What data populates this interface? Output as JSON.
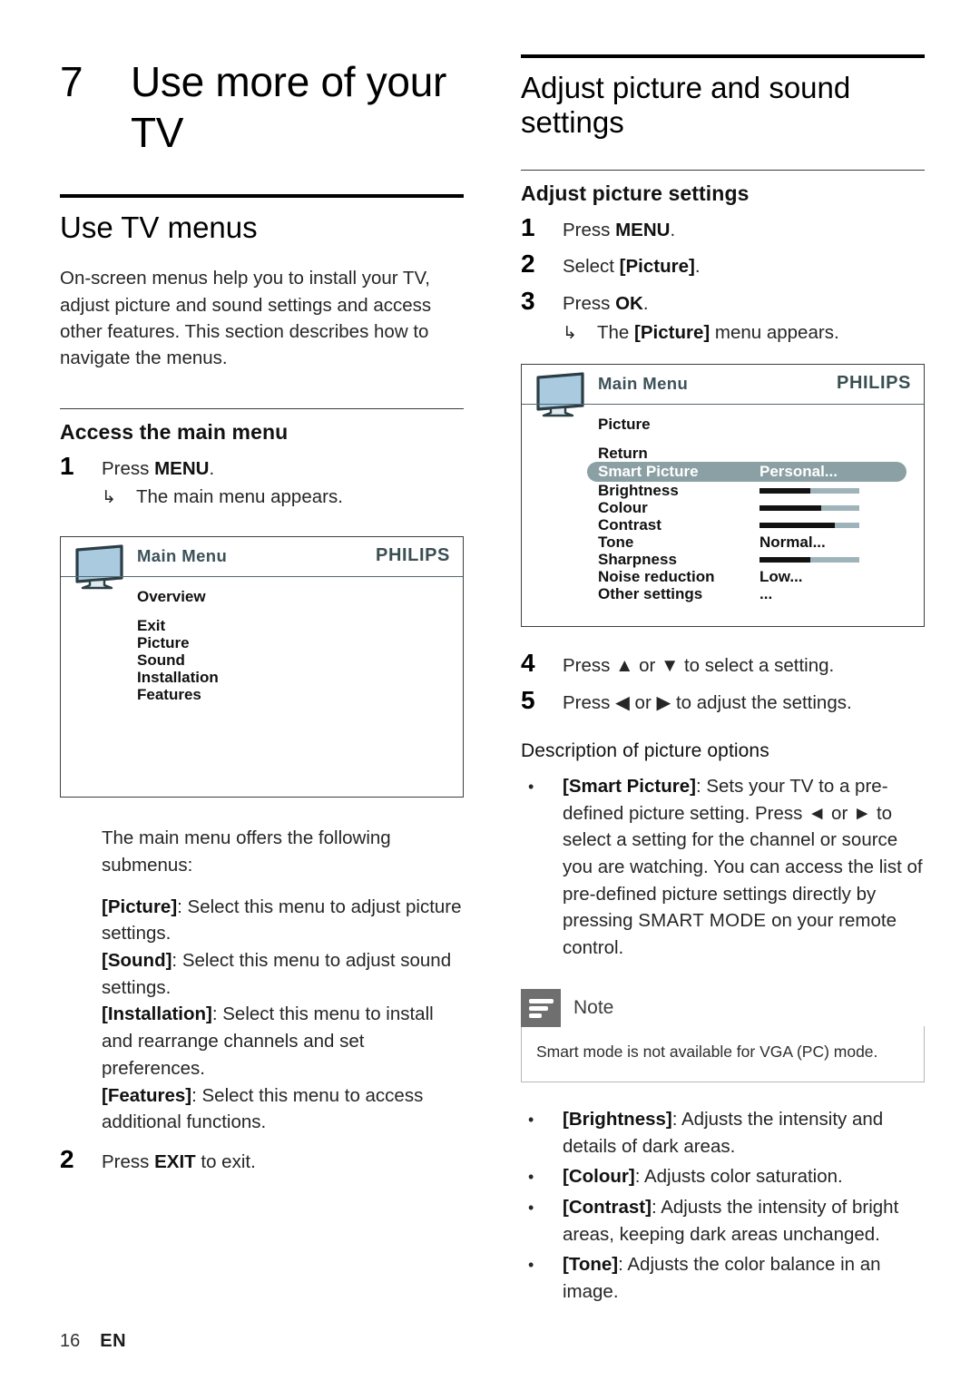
{
  "document": {
    "page_number": "16",
    "language_code": "EN"
  },
  "left_column": {
    "chapter": {
      "number": "7",
      "title": "Use more of your TV"
    },
    "section_title": "Use TV menus",
    "intro_paragraph": "On-screen menus help you to install your TV, adjust picture and sound settings and access other features. This section describes how to navigate the menus.",
    "subsection_title": "Access the main menu",
    "steps": [
      {
        "number": "1",
        "text": "Press MENU.",
        "bold_part": "MENU",
        "substep": "The main menu appears."
      },
      {
        "number": "2",
        "text": "Press EXIT to exit.",
        "bold_part": "EXIT"
      }
    ],
    "submenu_intro": "The main menu offers the following submenus:",
    "submenus": [
      {
        "name": "[Picture]",
        "description": ": Select this menu to adjust picture settings."
      },
      {
        "name": "[Sound]",
        "description": ": Select this menu to adjust sound settings."
      },
      {
        "name": "[Installation]",
        "description": ": Select this menu to install and rearrange channels and set preferences."
      },
      {
        "name": "[Features]",
        "description": ": Select this menu to access additional functions."
      }
    ],
    "osd": {
      "title": "Main Menu",
      "brand": "PHILIPS",
      "heading": "Overview",
      "items": [
        "Exit",
        "Picture",
        "Sound",
        "Installation",
        "Features"
      ]
    }
  },
  "right_column": {
    "section_title": "Adjust picture and sound settings",
    "subsection_title": "Adjust picture settings",
    "steps": [
      {
        "number": "1",
        "text": "Press MENU."
      },
      {
        "number": "2",
        "text": "Select [Picture]."
      },
      {
        "number": "3",
        "text": "Press OK.",
        "substep": "The [Picture] menu appears."
      },
      {
        "number": "4",
        "text": "Press ▲ or ▼ to select a setting."
      },
      {
        "number": "5",
        "text": "Press ◀ or ▶ to adjust the settings."
      }
    ],
    "osd": {
      "title": "Main Menu",
      "brand": "PHILIPS",
      "heading": "Picture",
      "return_label": "Return",
      "rows": [
        {
          "label": "Smart Picture",
          "value": "Personal...",
          "type": "value",
          "highlighted": true
        },
        {
          "label": "Brightness",
          "type": "slider",
          "fill": 51
        },
        {
          "label": "Colour",
          "type": "slider",
          "fill": 62
        },
        {
          "label": "Contrast",
          "type": "slider",
          "fill": 75
        },
        {
          "label": "Tone",
          "value": "Normal...",
          "type": "value"
        },
        {
          "label": "Sharpness",
          "type": "slider",
          "fill": 51
        },
        {
          "label": "Noise reduction",
          "value": "Low...",
          "type": "value"
        },
        {
          "label": "Other settings",
          "value": "...",
          "type": "value"
        }
      ]
    },
    "options_heading": "Description of picture options",
    "smart_picture_option": {
      "name": "[Smart Picture]",
      "description": ": Sets your TV to a pre-defined picture setting. Press ◀ or ▶ to select a setting for the channel or source you are watching. You can access the list of pre-defined picture settings directly by pressing SMART MODE on your remote control.",
      "emphasis": "SMART MODE"
    },
    "note": {
      "label": "Note",
      "text": "Smart mode is not available for VGA (PC) mode."
    },
    "options": [
      {
        "name": "[Brightness]",
        "description": ": Adjusts the intensity and details of dark areas."
      },
      {
        "name": "[Colour]",
        "description": ": Adjusts color saturation."
      },
      {
        "name": "[Contrast]",
        "description": ": Adjusts the intensity of bright areas, keeping dark areas unchanged."
      },
      {
        "name": "[Tone]",
        "description": ": Adjusts the color balance in an image."
      }
    ]
  },
  "colors": {
    "osd_title": "#3b5158",
    "osd_brand": "#3a4f52",
    "osd_highlight": "#8ba0a4",
    "slider_track": "#9fb4ba",
    "slider_fill": "#121212",
    "tv_screen": "#a9cadf",
    "note_icon_bg": "#6f6f6f"
  }
}
